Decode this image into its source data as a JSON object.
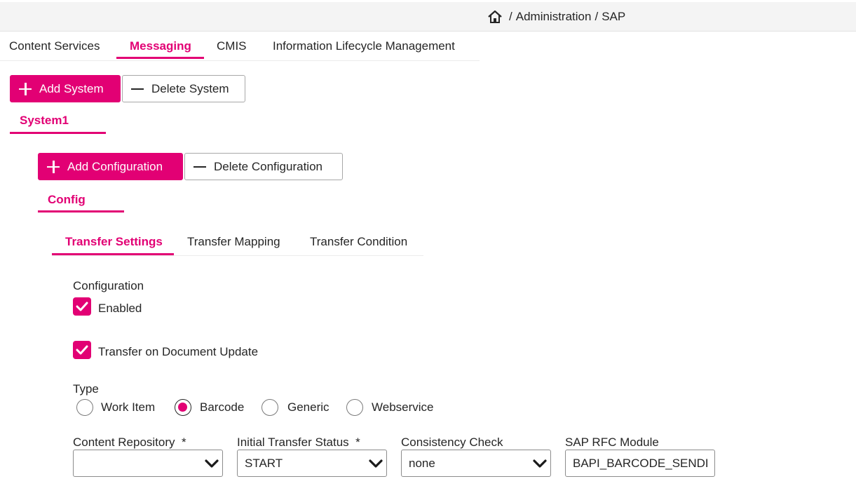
{
  "breadcrumb": {
    "items": [
      "Administration",
      "SAP"
    ],
    "separator": "/"
  },
  "main_tabs": [
    {
      "label": "Content Services",
      "active": false
    },
    {
      "label": "Messaging",
      "active": true
    },
    {
      "label": "CMIS",
      "active": false
    },
    {
      "label": "Information Lifecycle Management",
      "active": false
    }
  ],
  "system_actions": {
    "add_label": "Add System",
    "delete_label": "Delete System"
  },
  "system_tab": {
    "label": "System1"
  },
  "config_actions": {
    "add_label": "Add Configuration",
    "delete_label": "Delete Configuration"
  },
  "config_tab": {
    "label": "Config"
  },
  "transfer_tabs": [
    {
      "label": "Transfer Settings",
      "active": true
    },
    {
      "label": "Transfer Mapping",
      "active": false
    },
    {
      "label": "Transfer Condition",
      "active": false
    }
  ],
  "configuration": {
    "heading": "Configuration",
    "enabled_label": "Enabled",
    "enabled": true,
    "transfer_on_update_label": "Transfer on Document Update",
    "transfer_on_update": true
  },
  "type": {
    "heading": "Type",
    "options": [
      "Work Item",
      "Barcode",
      "Generic",
      "Webservice"
    ],
    "selected": "Barcode"
  },
  "fields": {
    "content_repository": {
      "label": "Content Repository",
      "required_mark": "*",
      "value": ""
    },
    "initial_transfer_status": {
      "label": "Initial Transfer Status",
      "required_mark": "*",
      "value": "START"
    },
    "consistency_check": {
      "label": "Consistency Check",
      "value": "none"
    },
    "sap_rfc_module": {
      "label": "SAP RFC Module",
      "value": "BAPI_BARCODE_SENDLI"
    }
  },
  "colors": {
    "accent": "#e20074",
    "text": "#262626",
    "topbar": "#f4f4f4"
  }
}
